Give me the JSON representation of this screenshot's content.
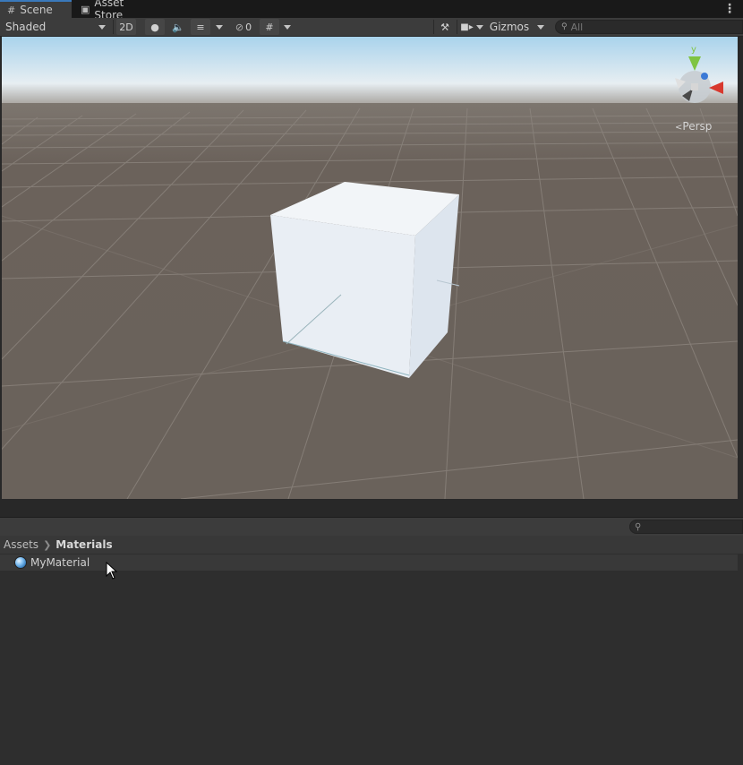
{
  "tabs": [
    {
      "label": "Scene",
      "icon": "grid-icon"
    },
    {
      "label": "Asset Store",
      "icon": "bag-icon"
    }
  ],
  "toolbar": {
    "draw_mode": "Shaded",
    "mode_2d": "2D",
    "hidden_count": "0",
    "gizmos_label": "Gizmos",
    "search_placeholder": "All"
  },
  "scene": {
    "projection_label": "Persp",
    "sky_colors": [
      "#a9d3ec",
      "#e7eef2"
    ],
    "ground_color": "#6b625b",
    "axes": {
      "y_label": "y",
      "x_color": "#d8392e",
      "y_color": "#7fc442",
      "z_color": "#3a79d6"
    }
  },
  "project": {
    "breadcrumb": [
      "Assets",
      "Materials"
    ],
    "items": [
      {
        "name": "MyMaterial",
        "icon": "material-sphere-icon"
      }
    ]
  }
}
